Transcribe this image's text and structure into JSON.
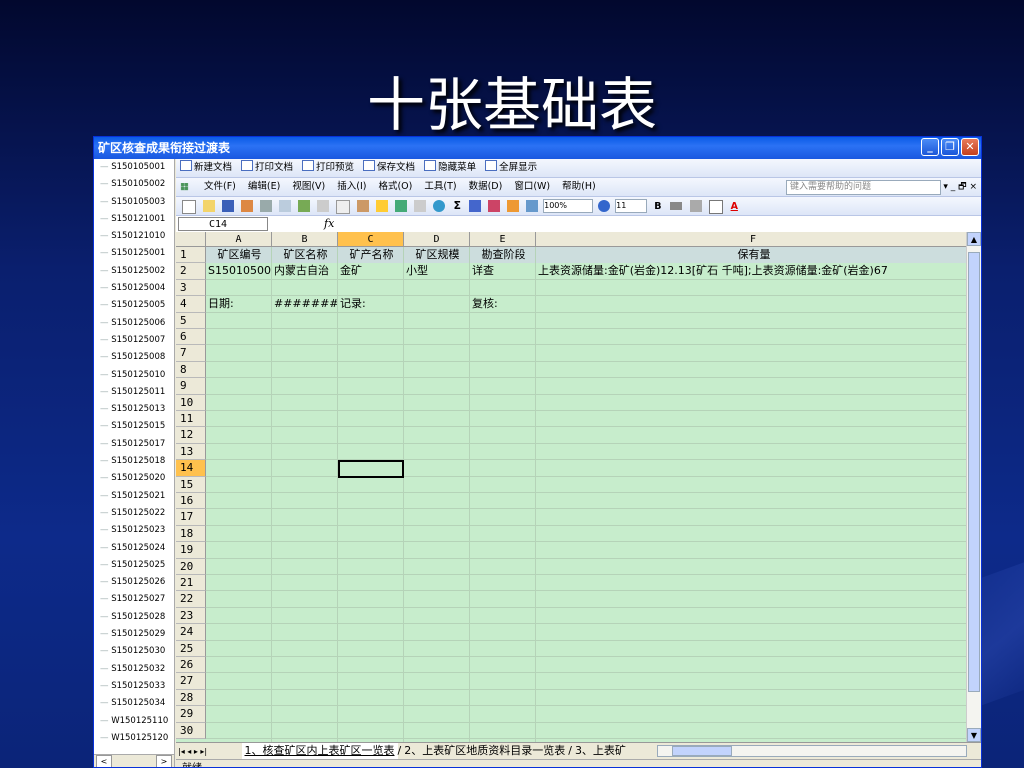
{
  "slide": {
    "title": "十张基础表"
  },
  "window": {
    "title": "矿区核查成果衔接过渡表"
  },
  "sidebar": {
    "items": [
      "S150105001",
      "S150105002",
      "S150105003",
      "S150121001",
      "S150121010",
      "S150125001",
      "S150125002",
      "S150125004",
      "S150125005",
      "S150125006",
      "S150125007",
      "S150125008",
      "S150125010",
      "S150125011",
      "S150125013",
      "S150125015",
      "S150125017",
      "S150125018",
      "S150125020",
      "S150125021",
      "S150125022",
      "S150125023",
      "S150125024",
      "S150125025",
      "S150125026",
      "S150125027",
      "S150125028",
      "S150125029",
      "S150125030",
      "S150125032",
      "S150125033",
      "S150125034",
      "W150125110",
      "W150125120"
    ],
    "scroll_left": "<",
    "scroll_right": ">"
  },
  "toolbar1": [
    "新建文档",
    "打印文档",
    "打印预览",
    "保存文档",
    "隐藏菜单",
    "全屏显示"
  ],
  "menubar": {
    "items": [
      "文件(F)",
      "编辑(E)",
      "视图(V)",
      "插入(I)",
      "格式(O)",
      "工具(T)",
      "数据(D)",
      "窗口(W)",
      "帮助(H)"
    ],
    "help_placeholder": "键入需要帮助的问题",
    "controls": "▾ _ 🗗 ×"
  },
  "toolbar2": {
    "zoom": "100%",
    "font_size": "11",
    "sigma": "Σ"
  },
  "formula": {
    "cell_ref": "C14",
    "fx": "fx"
  },
  "sheet": {
    "columns": [
      "A",
      "B",
      "C",
      "D",
      "E",
      "F"
    ],
    "row_numbers": [
      "1",
      "2",
      "3",
      "4",
      "5",
      "6",
      "7",
      "8",
      "9",
      "10",
      "11",
      "12",
      "13",
      "14",
      "15",
      "16",
      "17",
      "18",
      "19",
      "20",
      "21",
      "22",
      "23",
      "24",
      "25",
      "26",
      "27",
      "28",
      "29",
      "30"
    ],
    "row1": [
      "矿区编号",
      "矿区名称",
      "矿产名称",
      "矿区规模",
      "勘查阶段",
      "保有量"
    ],
    "row2": [
      "S15010500",
      "内蒙古自治",
      "金矿",
      "小型",
      "详查",
      "上表资源储量:金矿(岩金)12.13[矿石 千吨];上表资源储量:金矿(岩金)67"
    ],
    "row4": [
      "日期:",
      "########",
      "记录:",
      "",
      "复核:",
      ""
    ],
    "active_cell": "C14"
  },
  "tabs": {
    "nav": "|◂ ◂ ▸ ▸|",
    "items": [
      "1、核查矿区内上表矿区一览表",
      "2、上表矿区地质资料目录一览表",
      "3、上表矿"
    ]
  },
  "status": {
    "text": "就绪"
  }
}
